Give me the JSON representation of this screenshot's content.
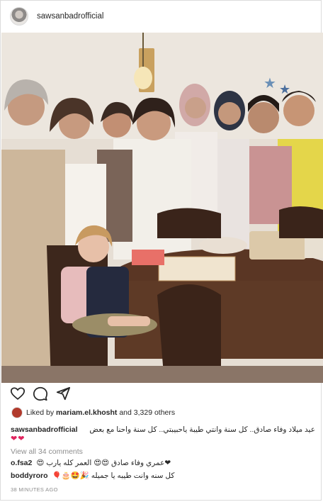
{
  "post": {
    "username": "sawsanbadrofficial",
    "likes": {
      "prefix": "Liked by",
      "liked_by_user": "mariam.el.khosht",
      "others": "and 3,329 others"
    },
    "caption": {
      "username": "sawsanbadrofficial",
      "text": "عيد ميلاد وفاء صادق.. كل سنة وانتي طيبة ياحبيبتي.. كل سنة واحنا مع بعض",
      "emoji": "❤❤"
    },
    "view_comments_label": "View all 34 comments",
    "comments": [
      {
        "username": "o.fsa2",
        "text": "❤عمري وفاء صادق 😍😍 العمر كله يارب 😍"
      },
      {
        "username": "boddyroro",
        "text": "كل سنه وانت طيبه يا جميله 🎉🤩🎂🎈"
      }
    ],
    "timestamp": "38 MINUTES AGO"
  },
  "icons": {
    "avatar": "profile-avatar",
    "like": "heart-icon",
    "comment": "comment-bubble-icon",
    "share": "paper-plane-icon"
  },
  "colors": {
    "text": "#262626",
    "muted": "#8e8e8e",
    "border": "#dbdbdb",
    "heart": "#e0245e"
  }
}
